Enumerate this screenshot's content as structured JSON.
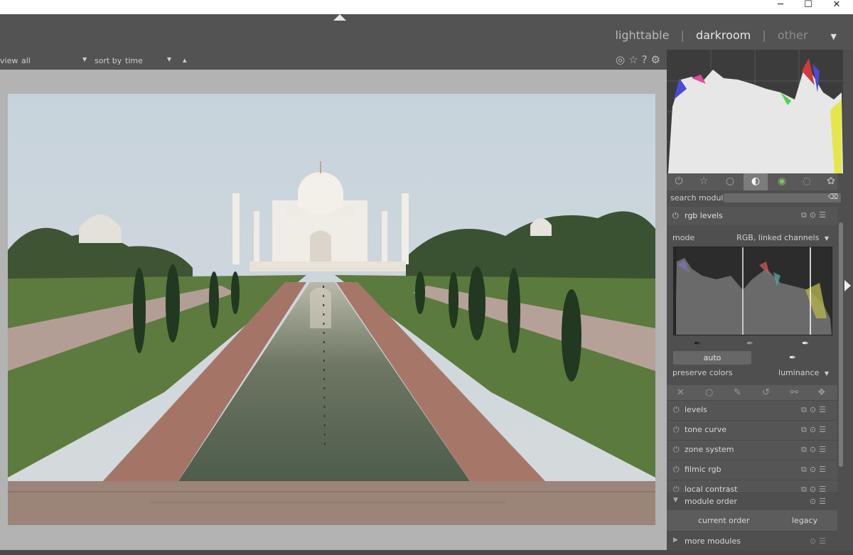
{
  "window": {
    "minimize_label": "─",
    "maximize_label": "☐",
    "close_label": "✕"
  },
  "views": {
    "lighttable": "lighttable",
    "darkroom": "darkroom",
    "other": "other",
    "separator": "|"
  },
  "filterbar": {
    "view_label": "view",
    "view_value": "all",
    "sort_label": "sort by",
    "sort_value": "time",
    "sort_dir": "▴",
    "icons": [
      "grid-icon",
      "star-icon",
      "help-icon",
      "gear-icon"
    ]
  },
  "module_tabs": [
    "power-icon",
    "star-icon",
    "circle-icon",
    "tone-icon",
    "color-icon",
    "correct-icon",
    "effect-icon"
  ],
  "search": {
    "label": "search module",
    "clear": "⌫"
  },
  "rgb_levels": {
    "title": "rgb levels",
    "mode_label": "mode",
    "mode_value": "RGB, linked channels",
    "auto_label": "auto",
    "preserve_label": "preserve colors",
    "preserve_value": "luminance"
  },
  "modules": [
    {
      "name": "levels"
    },
    {
      "name": "tone curve"
    },
    {
      "name": "zone system"
    },
    {
      "name": "filmic rgb"
    },
    {
      "name": "local contrast"
    }
  ],
  "module_order": {
    "title": "module order",
    "current": "current order",
    "legacy": "legacy"
  },
  "more_modules": "more modules",
  "colors": {
    "panel": "#4f4f4f",
    "header": "#535353",
    "center_bg": "#b3b3b3"
  }
}
